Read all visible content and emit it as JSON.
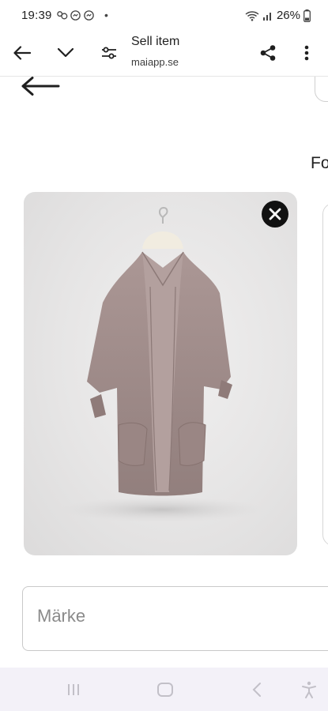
{
  "status_bar": {
    "time": "19:39",
    "battery_percent": "26%",
    "notification_icons": [
      "messenger-icon",
      "messenger-icon",
      "messenger-icon"
    ],
    "dot": "•"
  },
  "toolbar": {
    "title": "Sell item",
    "url": "maiapp.se"
  },
  "page": {
    "side_text": "Fo",
    "brand_field": {
      "placeholder": "Märke",
      "value": ""
    }
  },
  "icons": {
    "back": "back-arrow-icon",
    "chevron": "chevron-down-icon",
    "settings": "tune-icon",
    "share": "share-icon",
    "menu": "more-vert-icon",
    "remove": "close-icon",
    "nav_recents": "recents-icon",
    "nav_home": "home-icon",
    "nav_back": "nav-back-icon",
    "nav_accessibility": "accessibility-icon"
  },
  "colors": {
    "accent_dark": "#111111",
    "nav_bar_bg": "#f3f1f8",
    "coat": "#a08c8a"
  }
}
